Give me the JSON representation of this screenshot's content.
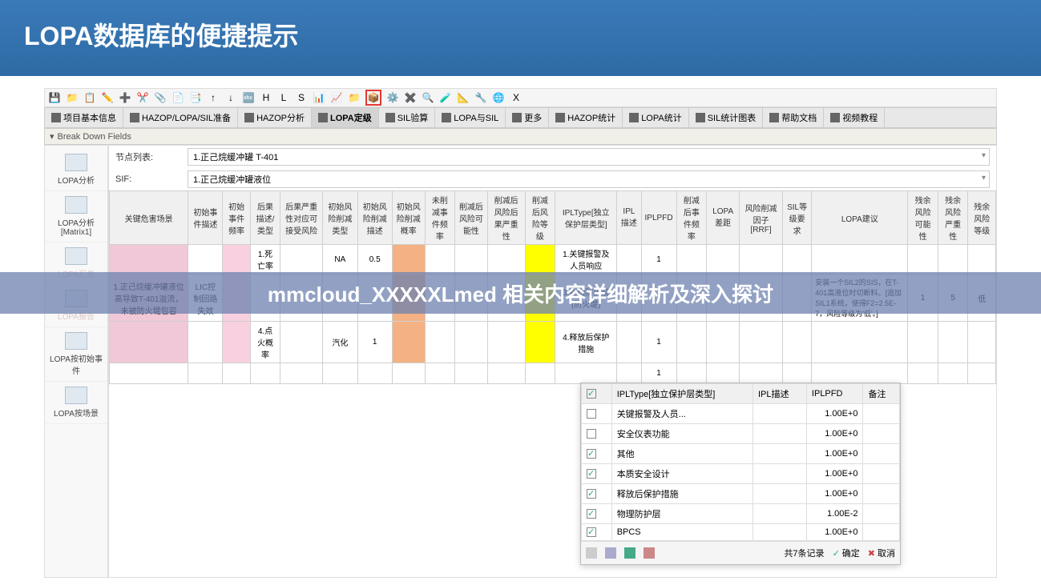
{
  "header": {
    "title": "LOPA数据库的便捷提示"
  },
  "overlay": "mmcloud_XXXXXLmed 相关内容详细解析及深入探讨",
  "tabs": [
    {
      "label": "项目基本信息"
    },
    {
      "label": "HAZOP/LOPA/SIL准备"
    },
    {
      "label": "HAZOP分析"
    },
    {
      "label": "LOPA定级",
      "active": true
    },
    {
      "label": "SIL验算"
    },
    {
      "label": "LOPA与SIL"
    },
    {
      "label": "更多"
    },
    {
      "label": "HAZOP统计"
    },
    {
      "label": "LOPA统计"
    },
    {
      "label": "SIL统计图表"
    },
    {
      "label": "帮助文档"
    },
    {
      "label": "视频教程"
    }
  ],
  "section": "Break Down Fields",
  "sidebar": [
    {
      "label": "LOPA分析"
    },
    {
      "label": "LOPA分析[Matrix1]"
    },
    {
      "label": "LOPA汇总",
      "faded": true
    },
    {
      "label": "LOPA报告",
      "faded": true
    },
    {
      "label": "LOPA按初始事件"
    },
    {
      "label": "LOPA按场景"
    }
  ],
  "form": {
    "f1": {
      "label": "节点列表:",
      "value": "1.正己烷缓冲罐 T-401"
    },
    "f2": {
      "label": "SIF:",
      "value": "1.正己烷缓冲罐液位"
    }
  },
  "gridHeaders": [
    "关键危害场景",
    "初始事件描述",
    "初始事件频率",
    "后果描述/类型",
    "后果严重性对应可接受风险",
    "初始风险削减类型",
    "初始风险削减描述",
    "初始风险削减概率",
    "未削减事件频率",
    "削减后风险可能性",
    "削减后风险后果严重性",
    "削减后风险等级",
    "IPLType[独立保护层类型]",
    "IPL描述",
    "IPLPFD",
    "削减后事件频率",
    "LOPA差距",
    "风险削减因子[RRF]",
    "SIL等级要求",
    "LOPA建议",
    "残余风险可能性",
    "残余风险严重性",
    "残余风险等级"
  ],
  "specialCols": {
    "gold": 14,
    "green": 16
  },
  "rows": [
    {
      "c0": "",
      "c3": "1.死亡率",
      "c5": "NA",
      "c6": "0.5",
      "c12": "1.关键报警及人员响应",
      "c14": "1"
    },
    {
      "c0": "1.正己烷缓冲罐液位高导致T-401溢流，未被防火堤包容",
      "c1": "LIC控制回路失效",
      "c12": "3.物理防护层(防火堤)",
      "c19": "安装一个SIL2的SIS，在T-401高液位时切断料。[追加SIL1系统，使得F2=2.5E-7，风险等级为'低'。]",
      "c20": "1",
      "c21": "5",
      "c22": "低"
    },
    {
      "c3": "4.点火概率",
      "c5": "汽化",
      "c6": "1",
      "c12": "4.释放后保护措施",
      "c14": "1"
    },
    {
      "c14": "1"
    }
  ],
  "popup": {
    "headers": [
      "IPLType[独立保护层类型]",
      "IPL描述",
      "IPLPFD",
      "备注"
    ],
    "rows": [
      {
        "chk": false,
        "c0": "关键报警及人员...",
        "c2": "1.00E+0"
      },
      {
        "chk": false,
        "c0": "安全仪表功能",
        "c2": "1.00E+0"
      },
      {
        "chk": true,
        "c0": "其他",
        "c2": "1.00E+0"
      },
      {
        "chk": true,
        "c0": "本质安全设计",
        "c2": "1.00E+0"
      },
      {
        "chk": true,
        "c0": "释放后保护措施",
        "c2": "1.00E+0"
      },
      {
        "chk": true,
        "c0": "物理防护层",
        "c2": "1.00E-2"
      },
      {
        "chk": true,
        "c0": "BPCS",
        "c2": "1.00E+0"
      }
    ],
    "count": "共7条记录",
    "ok": "确定",
    "cancel": "取消"
  },
  "toolbarIcons": [
    "💾",
    "📁",
    "📋",
    "✏️",
    "➕",
    "✂️",
    "📎",
    "📄",
    "📑",
    "↑",
    "↓",
    "🔤",
    "H",
    "L",
    "S",
    "📊",
    "📈",
    "📁",
    "📦",
    "⚙️",
    "✖️",
    "🔍",
    "🧪",
    "📐",
    "🔧",
    "🌐",
    "X"
  ]
}
